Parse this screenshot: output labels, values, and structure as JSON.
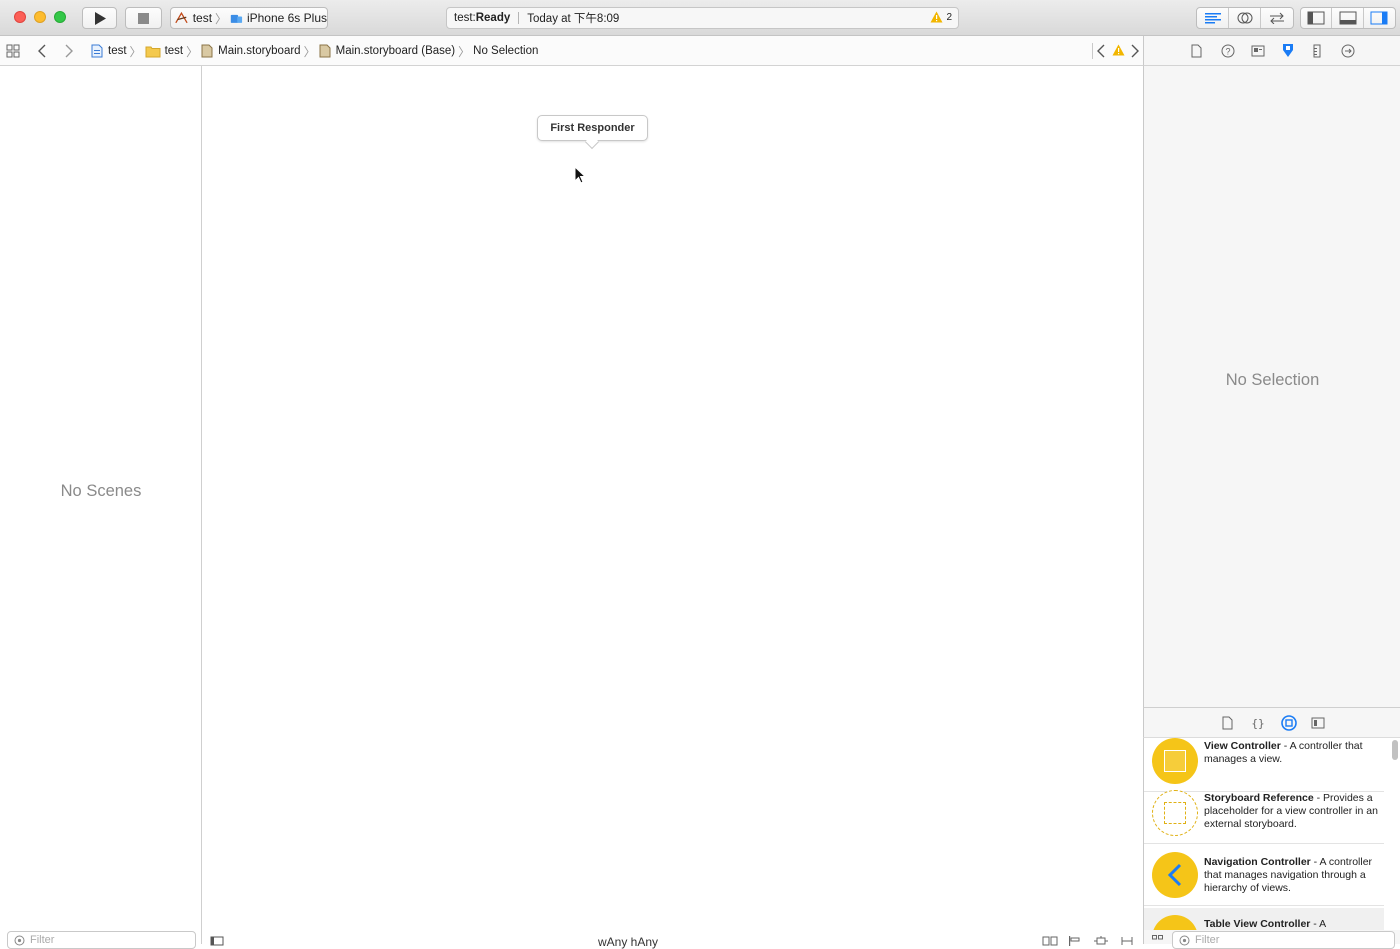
{
  "toolbar": {
    "scheme_name": "test",
    "device_name": "iPhone 6s Plus",
    "activity_project": "test: ",
    "activity_status": "Ready",
    "activity_time": "Today at 下午8:09",
    "warning_count": "2"
  },
  "jumpbar": {
    "crumbs": [
      "test",
      "test",
      "Main.storyboard",
      "Main.storyboard (Base)",
      "No Selection"
    ]
  },
  "outline": {
    "placeholder": "No Scenes",
    "filter_placeholder": "Filter"
  },
  "canvas": {
    "popover_label": "First Responder",
    "size_class": "wAny  hAny"
  },
  "inspector": {
    "placeholder": "No Selection"
  },
  "library": {
    "filter_placeholder": "Filter",
    "items": [
      {
        "title": "View Controller",
        "desc": " - A controller that manages a view."
      },
      {
        "title": "Storyboard Reference",
        "desc": " - Provides a placeholder for a view controller in an external storyboard."
      },
      {
        "title": "Navigation Controller",
        "desc": " - A controller that manages navigation through a hierarchy of views."
      },
      {
        "title": "Table View Controller",
        "desc": " - A"
      }
    ]
  },
  "colors": {
    "accent": "#1a7cf5",
    "library_yellow": "#f5c518",
    "warning": "#f2b600"
  }
}
